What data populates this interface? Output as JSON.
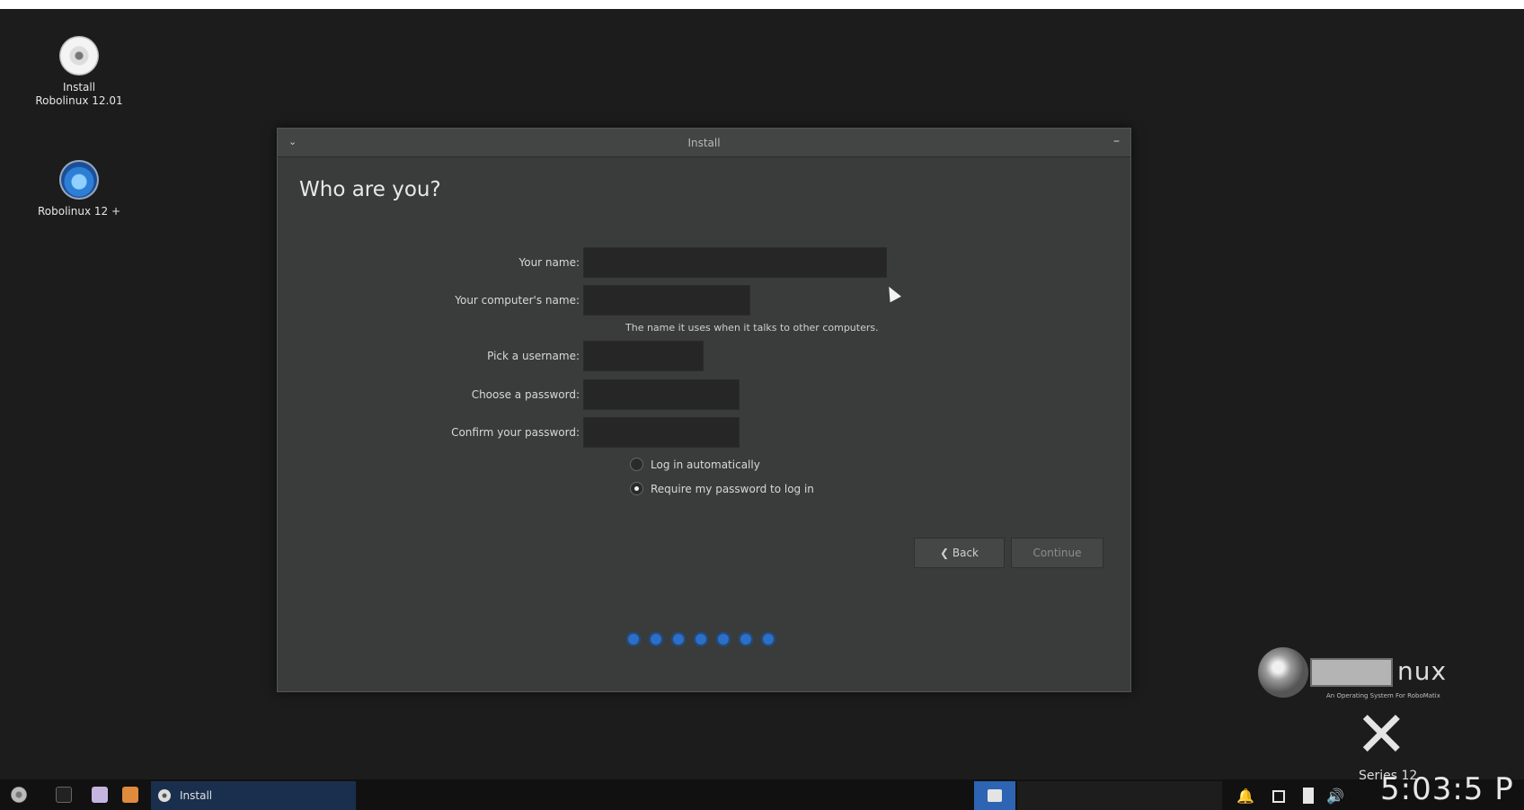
{
  "desktop": {
    "icons": [
      {
        "label_line1": "Install",
        "label_line2": "Robolinux 12.01",
        "icon": "disc-icon"
      },
      {
        "label_line1": "Robolinux 12 +",
        "icon": "robolinux-app-icon"
      }
    ]
  },
  "window": {
    "title": "Install",
    "menu_glyph": "⌄",
    "minimize_glyph": "–",
    "heading": "Who are you?",
    "fields": {
      "your_name": {
        "label": "Your name:",
        "value": ""
      },
      "computer_name": {
        "label": "Your computer's name:",
        "value": "",
        "hint": "The name it uses when it talks to other computers."
      },
      "username": {
        "label": "Pick a username:",
        "value": ""
      },
      "password": {
        "label": "Choose a password:",
        "value": ""
      },
      "confirm_password": {
        "label": "Confirm your password:",
        "value": ""
      }
    },
    "login_options": [
      {
        "label": "Log in automatically",
        "selected": false
      },
      {
        "label": "Require my password to log in",
        "selected": true
      }
    ],
    "buttons": {
      "back": "❮ Back",
      "continue": "Continue"
    },
    "progress_steps": 7
  },
  "branding": {
    "logo_text": "nux",
    "tagline": "An Operating System For RoboMatix",
    "series": "Series 12"
  },
  "taskbar": {
    "task_label": "Install",
    "clock": "5:03:5 P"
  },
  "colors": {
    "accent": "#2d64b4",
    "window_bg": "#3a3b3b",
    "field_bg": "#262626"
  }
}
